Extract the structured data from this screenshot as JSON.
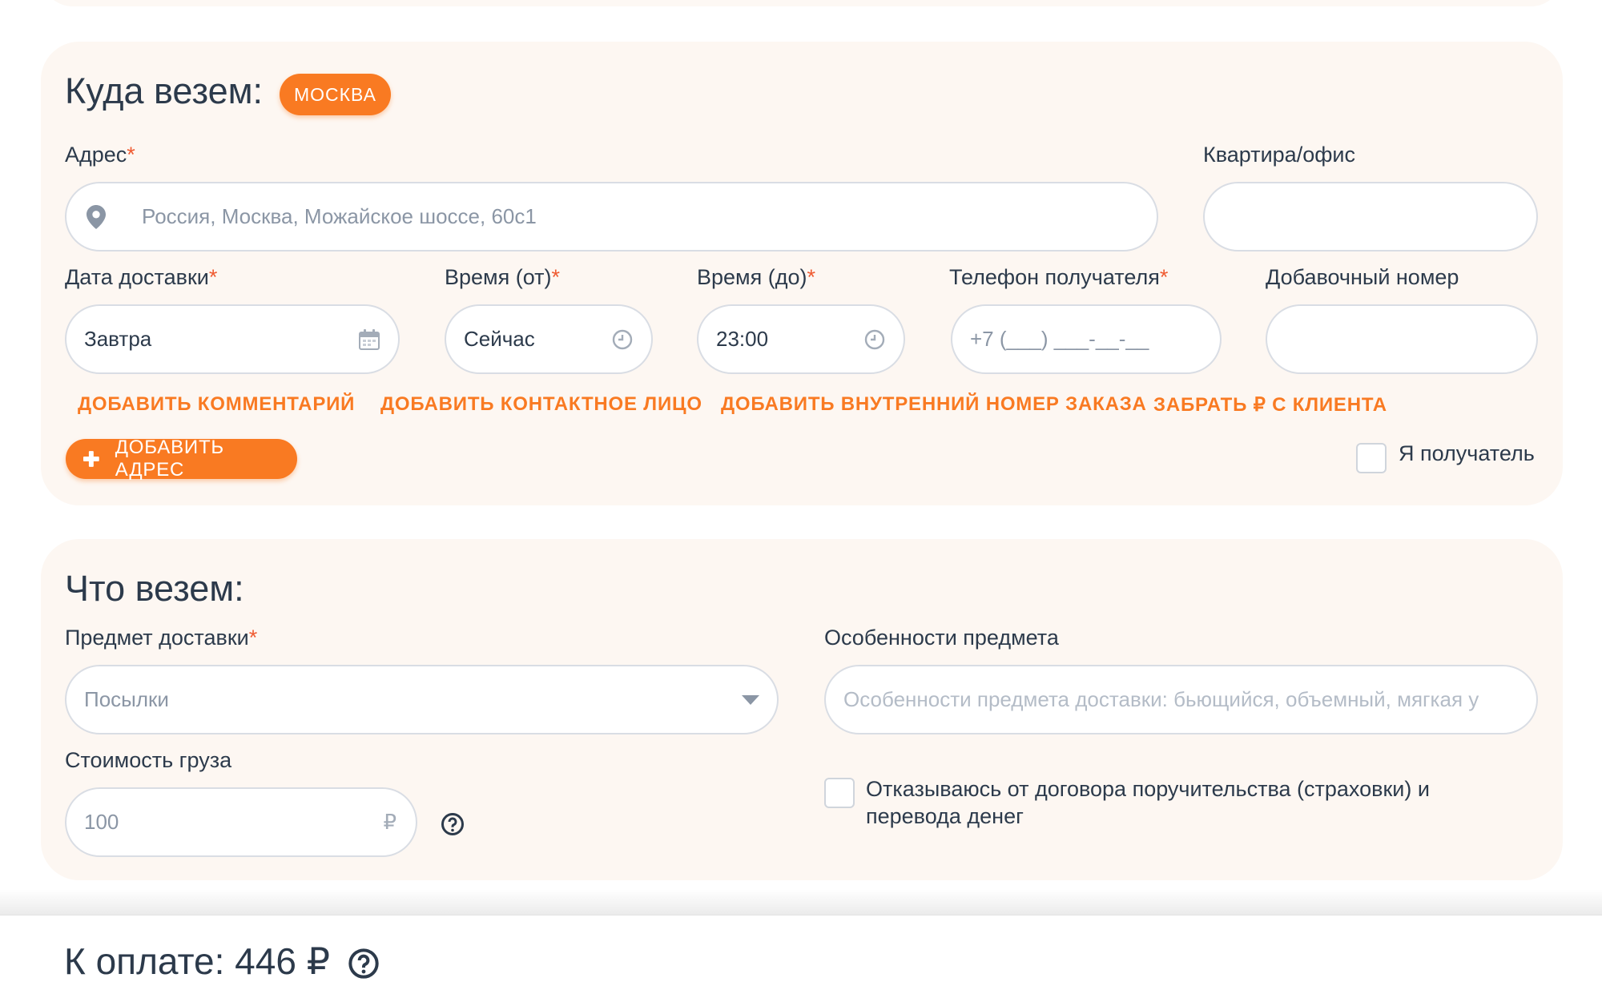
{
  "where": {
    "title": "Куда везем:",
    "city_badge": "МОСКВА",
    "address_label": "Адрес",
    "address_placeholder": "Россия, Москва, Можайское шоссе, 60с1",
    "apartment_label": "Квартира/офис",
    "apartment_value": "",
    "date_label": "Дата доставки",
    "date_value": "Завтра",
    "time_from_label": "Время (от)",
    "time_from_value": "Сейчас",
    "time_to_label": "Время (до)",
    "time_to_value": "23:00",
    "phone_label": "Телефон получателя",
    "phone_placeholder": "+7 (___) ___-__-__",
    "ext_label": "Добавочный номер",
    "ext_value": "",
    "required_mark": "*",
    "links": {
      "comment": "ДОБАВИТЬ КОММЕНТАРИЙ",
      "contact": "ДОБАВИТЬ КОНТАКТНОЕ ЛИЦО",
      "order_number": "ДОБАВИТЬ ВНУТРЕННИЙ НОМЕР ЗАКАЗА",
      "cash": "ЗАБРАТЬ ₽ С КЛИЕНТА"
    },
    "add_address_button": "ДОБАВИТЬ АДРЕС",
    "i_am_recipient_label": "Я получатель",
    "i_am_recipient_checked": false
  },
  "what": {
    "title": "Что везем:",
    "item_label": "Предмет доставки",
    "item_value": "Посылки",
    "features_label": "Особенности предмета",
    "features_placeholder": "Особенности предмета доставки: бьющийся, объемный, мягкая у",
    "cost_label": "Стоимость груза",
    "cost_placeholder": "100",
    "currency": "₽",
    "waiver_label_line1": "Отказываюсь от договора поручительства (страховки) и",
    "waiver_label_line2": "перевода денег",
    "waiver_checked": false
  },
  "footer": {
    "total_label": "К оплате: 446 ₽"
  },
  "colors": {
    "accent": "#f97a22",
    "required": "#ef5b32",
    "card_bg": "#fdf7f2",
    "text": "#2c3a4b"
  }
}
